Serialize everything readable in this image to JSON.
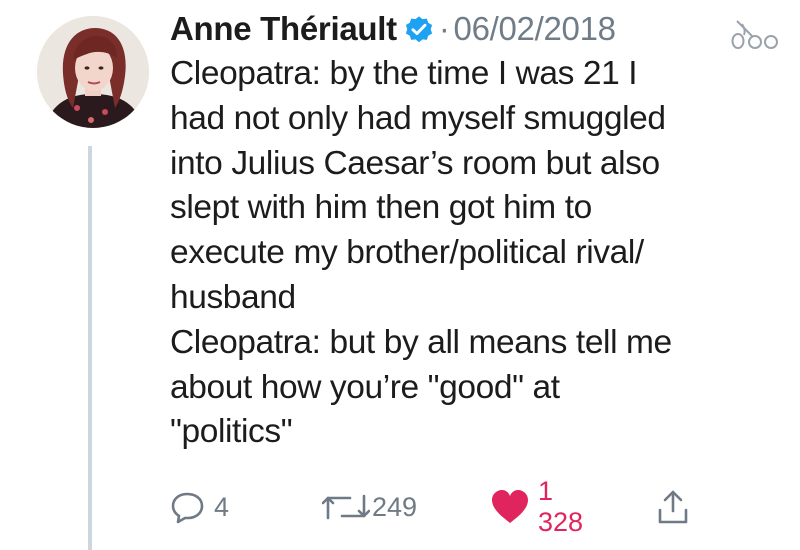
{
  "tweet": {
    "author_name": "Anne Thériault",
    "separator": "·",
    "date": "06/02/2018",
    "text_lines": [
      "Cleopatra: by the time I was 21 I",
      "had not only had myself smuggled",
      "into Julius Caesar’s room but also",
      "slept with him then got him to",
      "execute my brother/political rival/",
      "husband",
      "Cleopatra: but by all means tell me",
      "about how you’re \"good\" at",
      "\"politics\""
    ],
    "reply_count": "4",
    "retweet_count": "249",
    "like_count": "1 328"
  },
  "colors": {
    "verified": "#1da1f2",
    "like": "#e0245e",
    "muted": "#707d88"
  },
  "icons": [
    "avatar",
    "verified-badge-icon",
    "caret-icon",
    "reply-icon",
    "retweet-icon",
    "heart-icon",
    "share-icon"
  ]
}
